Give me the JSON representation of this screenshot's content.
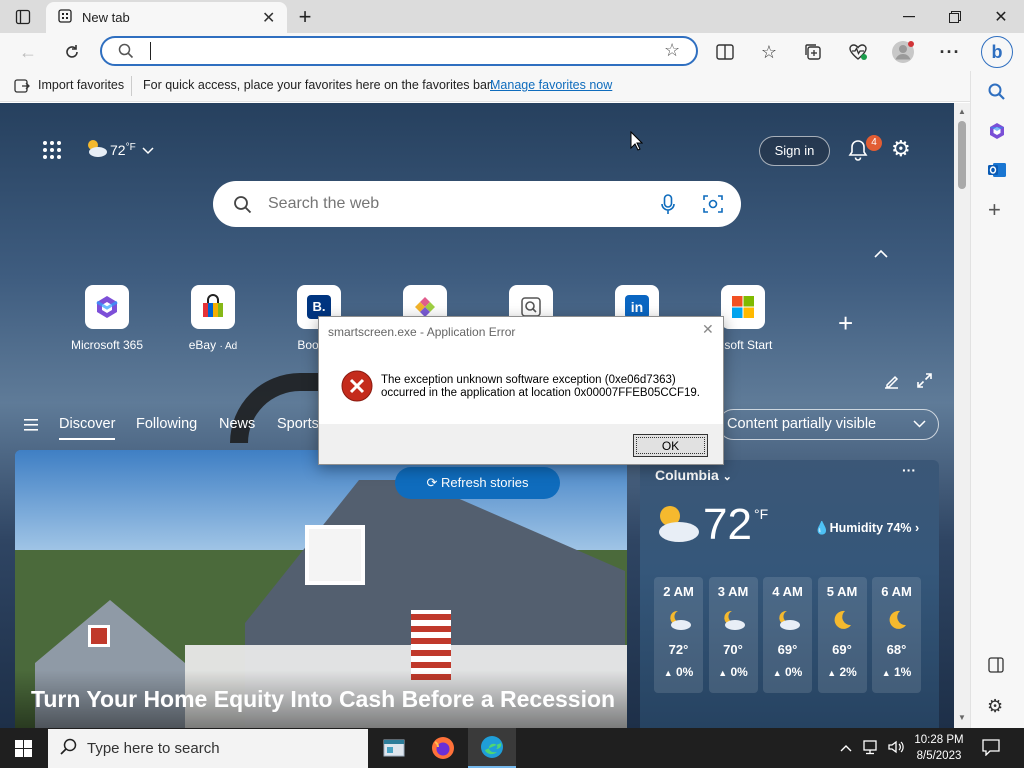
{
  "browser": {
    "tab_title": "New tab",
    "address_value": "",
    "favbar": {
      "import_label": "Import favorites",
      "hint": "For quick access, place your favorites here on the favorites bar.",
      "manage_link": "Manage favorites now"
    }
  },
  "newtab": {
    "weather_temp": "72",
    "weather_unit": "°F",
    "sign_in": "Sign in",
    "notification_count": "4",
    "search_placeholder": "Search the web",
    "shortcuts": [
      {
        "label": "Microsoft 365"
      },
      {
        "label": "eBay",
        "ad": "· Ad"
      },
      {
        "label": "Booking"
      },
      {
        "label": ""
      },
      {
        "label": ""
      },
      {
        "label": ""
      },
      {
        "label": "rosoft Start"
      }
    ],
    "nav": [
      "Discover",
      "Following",
      "News",
      "Sports"
    ],
    "content_visibility": "Content partially visible",
    "refresh_label": "Refresh stories",
    "hero_headline": "Turn Your Home Equity Into Cash Before a Recession"
  },
  "weather_card": {
    "location": "Columbia",
    "temp": "72",
    "unit": "°F",
    "humidity": "Humidity 74%",
    "hours": [
      {
        "time": "2 AM",
        "temp": "72°",
        "precip": "0%",
        "icon": "partly-cloudy-night-icon"
      },
      {
        "time": "3 AM",
        "temp": "70°",
        "precip": "0%",
        "icon": "partly-cloudy-night-icon"
      },
      {
        "time": "4 AM",
        "temp": "69°",
        "precip": "0%",
        "icon": "partly-cloudy-night-icon"
      },
      {
        "time": "5 AM",
        "temp": "69°",
        "precip": "2%",
        "icon": "moon-icon"
      },
      {
        "time": "6 AM",
        "temp": "68°",
        "precip": "1%",
        "icon": "moon-icon"
      }
    ]
  },
  "dialog": {
    "title": "smartscreen.exe - Application Error",
    "message_line1": "The exception unknown software exception (0xe06d7363)",
    "message_line2": "occurred in the application at location 0x00007FFEB05CCF19.",
    "ok_label": "OK"
  },
  "taskbar": {
    "search_placeholder": "Type here to search",
    "time": "10:28 PM",
    "date": "8/5/2023"
  },
  "colors": {
    "accent": "#0f6cbd",
    "error_red": "#c42b1c",
    "notification_badge": "#e25d33"
  }
}
